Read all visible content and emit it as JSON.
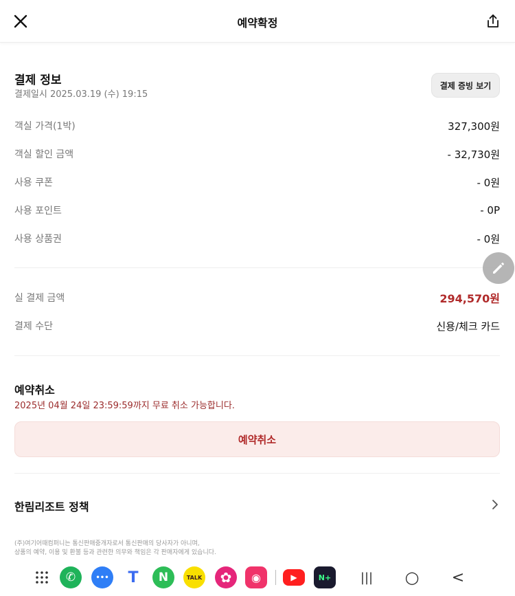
{
  "header": {
    "title": "예약확정"
  },
  "payment": {
    "title": "결제 정보",
    "datetime": "결제일시 2025.03.19 (수) 19:15",
    "receipt_button": "결제 증빙 보기",
    "rows": [
      {
        "label": "객실 가격(1박)",
        "value": "327,300원"
      },
      {
        "label": "객실 할인 금액",
        "value": "- 32,730원"
      },
      {
        "label": "사용 쿠폰",
        "value": "- 0원"
      },
      {
        "label": "사용 포인트",
        "value": "- 0P"
      },
      {
        "label": "사용 상품권",
        "value": "- 0원"
      }
    ],
    "actual_label": "실 결제 금액",
    "actual_value": "294,570원",
    "method_label": "결제 수단",
    "method_value": "신용/체크 카드"
  },
  "cancel": {
    "title": "예약취소",
    "note": "2025년 04월 24일 23:59:59까지 무료 취소 가능합니다.",
    "button": "예약취소"
  },
  "policy": {
    "title": "한림리조트 정책"
  },
  "footer": {
    "line1": "(주)여기어때컴퍼니는 통신판매중개자로서 통신판매의 당사자가 아니며,",
    "line2": "상품의 예약, 이용 및 환불 등과 관련한 의무와 책임은 각 판매자에게 있습니다."
  },
  "navbar": {
    "apps": [
      {
        "name": "apps-grid-icon",
        "glyph": "⋮⋮⋮"
      },
      {
        "name": "phone-app-icon",
        "glyph": "✆"
      },
      {
        "name": "messages-app-icon",
        "glyph": "•••"
      },
      {
        "name": "tmap-app-icon",
        "glyph": "T"
      },
      {
        "name": "naver-app-icon",
        "glyph": "N"
      },
      {
        "name": "kakaotalk-app-icon",
        "glyph": "TALK"
      },
      {
        "name": "flower-app-icon",
        "glyph": "✿"
      },
      {
        "name": "camera-app-icon",
        "glyph": "◉"
      },
      {
        "name": "youtube-app-icon",
        "glyph": "▶"
      },
      {
        "name": "naver-plus-app-icon",
        "glyph": "N+"
      }
    ],
    "recents": "|||",
    "home": "○",
    "back": "<"
  },
  "colors": {
    "accent_red": "#b02a2a",
    "cancel_bg": "#fbecea"
  }
}
